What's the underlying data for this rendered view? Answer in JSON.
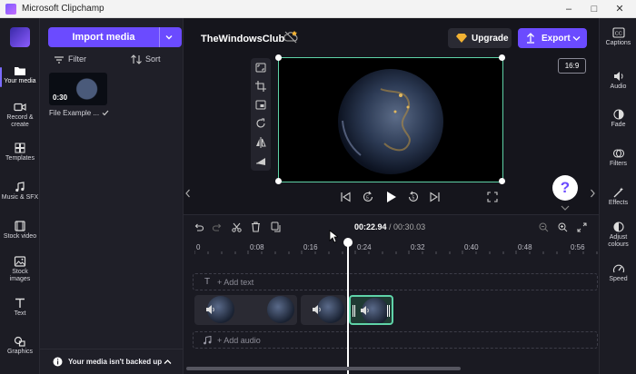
{
  "window": {
    "title": "Microsoft Clipchamp"
  },
  "rail": {
    "items": [
      {
        "label": "Your media",
        "icon": "folder-icon"
      },
      {
        "label": "Record &",
        "label2": "create",
        "icon": "camera-icon"
      },
      {
        "label": "Templates",
        "icon": "templates-icon"
      },
      {
        "label": "Music & SFX",
        "icon": "music-icon"
      },
      {
        "label": "Stock video",
        "icon": "film-icon"
      },
      {
        "label": "Stock",
        "label2": "images",
        "icon": "image-icon"
      },
      {
        "label": "Text",
        "icon": "text-icon"
      },
      {
        "label": "Graphics",
        "icon": "graphics-icon"
      }
    ]
  },
  "media": {
    "import_label": "Import media",
    "filter_label": "Filter",
    "sort_label": "Sort",
    "thumb_time": "0:30",
    "thumb_name": "File Example ...",
    "backup_text": "Your media isn't backed up"
  },
  "header": {
    "project_name": "TheWindowsClub",
    "upgrade_label": "Upgrade",
    "export_label": "Export",
    "ratio_label": "16:9"
  },
  "help": {
    "label": "?"
  },
  "rightpanel": {
    "items": [
      {
        "label": "Captions",
        "icon": "captions-icon"
      },
      {
        "label": "Audio",
        "icon": "speaker-icon"
      },
      {
        "label": "Fade",
        "icon": "fade-icon"
      },
      {
        "label": "Filters",
        "icon": "filters-icon"
      },
      {
        "label": "Effects",
        "icon": "effects-icon"
      },
      {
        "label": "Adjust",
        "label2": "colours",
        "icon": "adjust-icon"
      },
      {
        "label": "Speed",
        "icon": "speed-icon"
      }
    ]
  },
  "timeline": {
    "current_time": "00:22.94",
    "total_time": "/ 00:30.03",
    "ticks": [
      "0",
      "0:08",
      "0:16",
      "0:24",
      "0:32",
      "0:40",
      "0:48",
      "0:56"
    ],
    "add_text": "+ Add text",
    "add_audio": "+ Add audio",
    "text_track_icon": "T"
  },
  "colors": {
    "accent": "#6b4bff",
    "selection": "#5fd3a8"
  }
}
